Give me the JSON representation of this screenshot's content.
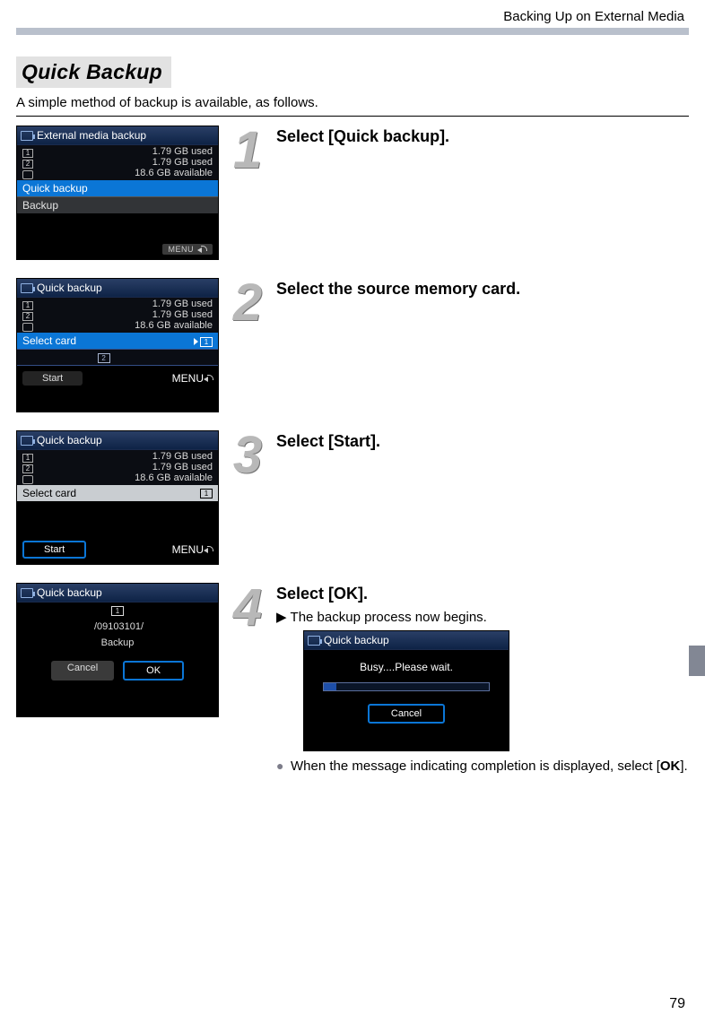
{
  "header": "Backing Up on External Media",
  "section_title": "Quick Backup",
  "intro": "A simple method of backup is available, as follows.",
  "page_number": "79",
  "menu_label": "MENU",
  "screens": {
    "external_title": "External media backup",
    "quick_title": "Quick backup",
    "slot1_used": "1.79 GB used",
    "slot2_used": "1.79 GB used",
    "available": "18.6 GB available",
    "quick_backup_item": "Quick backup",
    "backup_item": "Backup",
    "select_card": "Select card",
    "start": "Start",
    "path": "/09103101/",
    "backup_label": "Backup",
    "cancel": "Cancel",
    "ok": "OK",
    "busy_text": "Busy....Please wait."
  },
  "steps": {
    "s1": {
      "num": "1",
      "title": "Select [Quick backup]."
    },
    "s2": {
      "num": "2",
      "title": "Select the source memory card."
    },
    "s3": {
      "num": "3",
      "title": "Select [Start]."
    },
    "s4": {
      "num": "4",
      "title": "Select [OK].",
      "sub": "The backup process now begins.",
      "bullet_pre": "When the message indicating completion is displayed, select [",
      "bullet_bold": "OK",
      "bullet_post": "]."
    }
  }
}
